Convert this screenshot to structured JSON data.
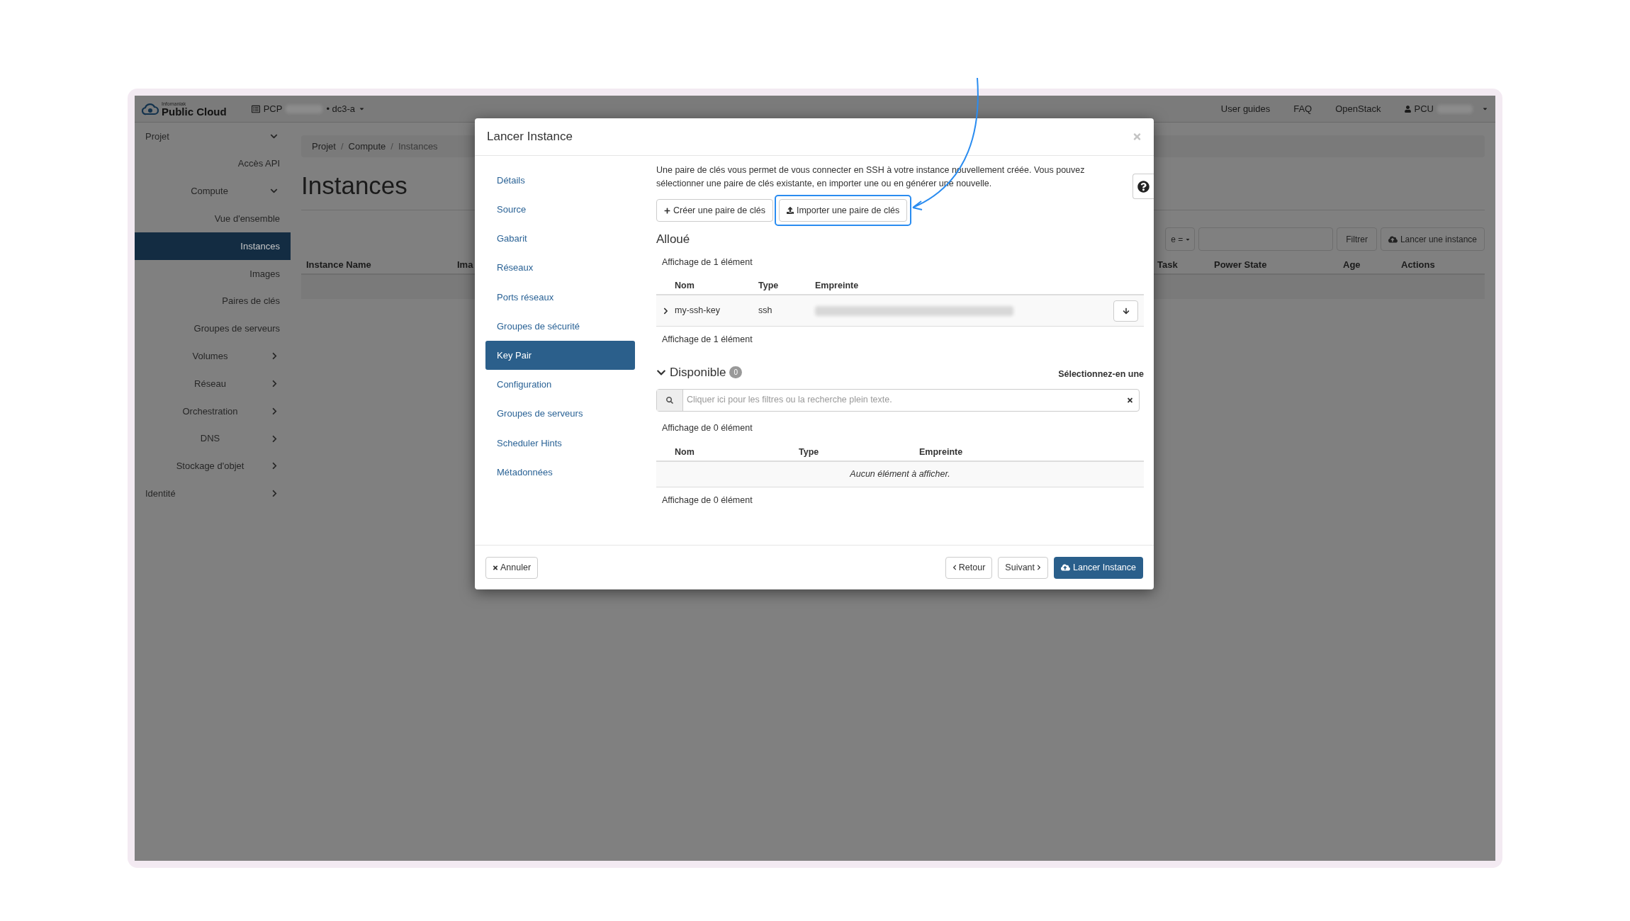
{
  "topbar": {
    "brand_small": "Infomaniak",
    "brand": "Public Cloud",
    "project_label": "PCP",
    "region": "• dc3-a",
    "links": [
      "User guides",
      "FAQ",
      "OpenStack"
    ],
    "user": "PCU"
  },
  "sidebar": {
    "items": [
      {
        "label": "Projet",
        "selected": false,
        "expanded": true,
        "children": [
          {
            "label": "Accès API",
            "selected": false
          },
          {
            "label": "Compute",
            "selected": false,
            "expanded": true,
            "children": [
              {
                "label": "Vue d'ensemble",
                "selected": false
              },
              {
                "label": "Instances",
                "selected": true
              },
              {
                "label": "Images",
                "selected": false
              },
              {
                "label": "Paires de clés",
                "selected": false
              },
              {
                "label": "Groupes de serveurs",
                "selected": false
              }
            ]
          },
          {
            "label": "Volumes",
            "selected": false,
            "expanded": false
          },
          {
            "label": "Réseau",
            "selected": false,
            "expanded": false
          },
          {
            "label": "Orchestration",
            "selected": false,
            "expanded": false
          },
          {
            "label": "DNS",
            "selected": false,
            "expanded": false
          },
          {
            "label": "Stockage d'objet",
            "selected": false,
            "expanded": false
          }
        ]
      },
      {
        "label": "Identité",
        "selected": false,
        "expanded": false
      }
    ]
  },
  "main": {
    "breadcrumb": [
      "Projet",
      "Compute",
      "Instances"
    ],
    "separator": "/",
    "title": "Instances",
    "filter_fragment": "e =",
    "filter_button": "Filtrer",
    "launch_button": "Lancer une instance",
    "columns": [
      "Instance Name",
      "Ima",
      "Task",
      "Power State",
      "Age",
      "Actions"
    ]
  },
  "modal": {
    "title": "Lancer Instance",
    "steps": [
      {
        "label": "Détails",
        "selected": false
      },
      {
        "label": "Source",
        "selected": false
      },
      {
        "label": "Gabarit",
        "selected": false
      },
      {
        "label": "Réseaux",
        "selected": false
      },
      {
        "label": "Ports réseaux",
        "selected": false
      },
      {
        "label": "Groupes de sécurité",
        "selected": false
      },
      {
        "label": "Key Pair",
        "selected": true
      },
      {
        "label": "Configuration",
        "selected": false
      },
      {
        "label": "Groupes de serveurs",
        "selected": false
      },
      {
        "label": "Scheduler Hints",
        "selected": false
      },
      {
        "label": "Métadonnées",
        "selected": false
      }
    ],
    "description": "Une paire de clés vous permet de vous connecter en SSH à votre instance nouvellement créée. Vous pouvez sélectionner une paire de clés existante, en importer une ou en générer une nouvelle.",
    "create_button": "Créer une paire de clés",
    "import_button": {
      "label": "Importer une paire de clés",
      "highlighted": true
    },
    "allocated": {
      "title": "Alloué",
      "count_top": "Affichage de 1 élément",
      "columns": [
        "Nom",
        "Type",
        "Empreinte"
      ],
      "rows": [
        {
          "name": "my-ssh-key",
          "type": "ssh",
          "expanded": false
        }
      ],
      "count_bottom": "Affichage de 1 élément"
    },
    "available": {
      "title": "Disponible",
      "badge": "0",
      "expanded": true,
      "hint": "Sélectionnez-en une",
      "search": {
        "placeholder": "Cliquer ici pour les filtres ou la recherche plein texte."
      },
      "count_top": "Affichage de 0 élément",
      "columns": [
        "Nom",
        "Type",
        "Empreinte"
      ],
      "empty": "Aucun élément à afficher.",
      "count_bottom": "Affichage de 0 élément"
    },
    "footer": {
      "cancel": "Annuler",
      "back": "Retour",
      "next": "Suivant",
      "launch": "Lancer Instance"
    }
  }
}
